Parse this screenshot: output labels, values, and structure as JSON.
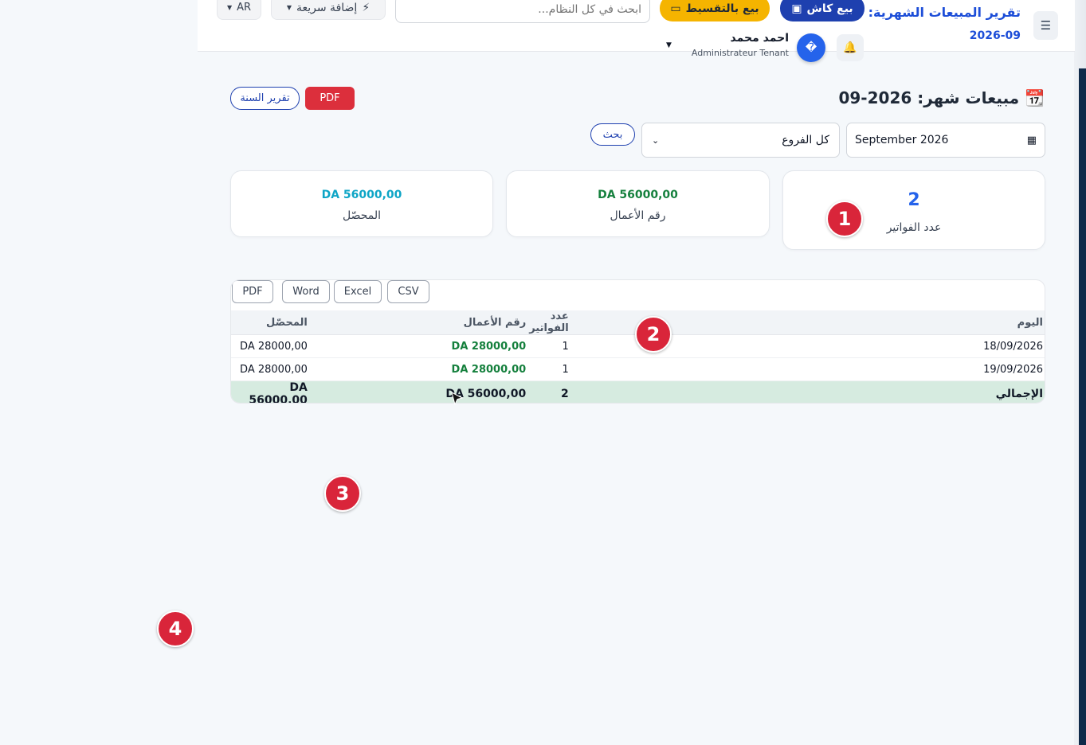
{
  "header": {
    "title": "تقرير المبيعات الشهرية:",
    "subtitle": "2026-09",
    "cash_sale_label": "بيع كاش",
    "installment_sale_label": "بيع بالتقسيط",
    "search_placeholder": "ابحث في كل النظام...",
    "quick_add_label": "إضافة سريعة",
    "language_label": "AR",
    "user_name": "احمد محمد",
    "user_role": "Administrateur Tenant",
    "avatar_glyph": "�"
  },
  "page": {
    "title": "📆 مبيعات شهر: 2026-09",
    "pdf_label": "PDF",
    "year_report_label": "تقرير السنة"
  },
  "filters": {
    "month_value": "September 2026",
    "branch_value": "كل الفروع",
    "search_label": "بحث"
  },
  "stats": {
    "invoice_count": "2",
    "invoice_count_label": "عدد الفواتير",
    "revenue": "DA 56000,00",
    "revenue_label": "رقم الأعمال",
    "collected": "DA 56000,00",
    "collected_label": "المحصّل"
  },
  "table": {
    "export_buttons": {
      "pdf": "PDF",
      "word": "Word",
      "excel": "Excel",
      "csv": "CSV"
    },
    "headers": {
      "day": "اليوم",
      "invoice_count": "عدد الفواتير",
      "revenue": "رقم الأعمال",
      "collected": "المحصّل"
    },
    "rows": [
      {
        "day": "18/09/2026",
        "invoice_count": "1",
        "revenue": "DA 28000,00",
        "collected": "DA 28000,00"
      },
      {
        "day": "19/09/2026",
        "invoice_count": "1",
        "revenue": "DA 28000,00",
        "collected": "DA 28000,00"
      }
    ],
    "total": {
      "label": "الإجمالي",
      "invoice_count": "2",
      "revenue": "DA 56000,00",
      "collected": "DA 56000,00"
    }
  },
  "markers": [
    "1",
    "2",
    "3",
    "4"
  ],
  "colors": {
    "primary": "#1e40af",
    "danger": "#dc2f3c",
    "warning": "#f5b400",
    "success": "#15803d",
    "info": "#0ea5c6",
    "marker": "#d9253a"
  }
}
